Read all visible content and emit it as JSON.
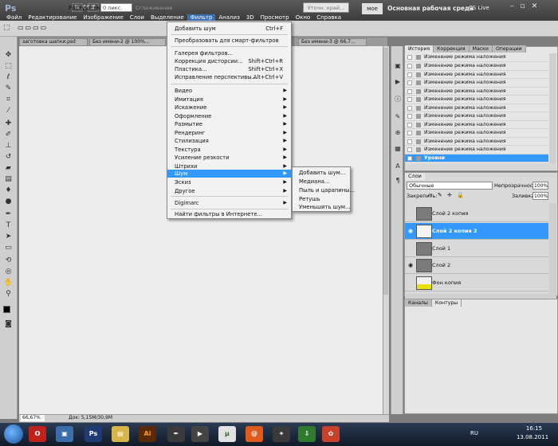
{
  "app": {
    "logo": "Ps",
    "zoom": "66,7",
    "workspace_chip": "мое",
    "workspace": "Основная рабочая среда",
    "cslive": "CS Live"
  },
  "menubar": [
    "Файл",
    "Редактирование",
    "Изображение",
    "Слои",
    "Выделение",
    "Фильтр",
    "Анализ",
    "3D",
    "Просмотр",
    "Окно",
    "Справка"
  ],
  "options": {
    "feather_label": "Растушевка:",
    "feather_value": "0 пикс.",
    "smooth": "Сглаживание",
    "refine": "Уточн. край..."
  },
  "doc_tabs": [
    "заготовка шапки.psd",
    "Без имени-2 @ 100%...",
    "Ф",
    "Без имени-3 @ 66,7..."
  ],
  "filter_menu": {
    "last_filter": "Добавить шум",
    "last_filter_shortcut": "Ctrl+F",
    "smart": "Преобразовать для смарт-фильтров",
    "gallery": "Галерея фильтров...",
    "lens": "Коррекция дисторсии...",
    "lens_shortcut": "Shift+Ctrl+R",
    "liquify": "Пластика...",
    "liquify_shortcut": "Shift+Ctrl+X",
    "vanish": "Исправление перспективы...",
    "vanish_shortcut": "Alt+Ctrl+V",
    "groups": [
      "Видео",
      "Имитация",
      "Искажение",
      "Оформление",
      "Размытие",
      "Рендеринг",
      "Стилизация",
      "Текстура",
      "Усиление резкости",
      "Штрихи",
      "Шум",
      "Эскиз",
      "Другое"
    ],
    "digimarc": "Digimarc",
    "online": "Найти фильтры в Интернете..."
  },
  "noise_submenu": [
    "Добавить шум...",
    "Медиана...",
    "Пыль и царапины...",
    "Ретушь",
    "Уменьшить шум..."
  ],
  "history": {
    "tabs": [
      "История",
      "Коррекция",
      "Маски",
      "Операции"
    ],
    "item": "Изменение режима наложения",
    "selected": "Уровни"
  },
  "layers": {
    "tab": "Слои",
    "blend_mode": "Обычные",
    "opacity_label": "Непрозрачность:",
    "opacity": "100%",
    "lock_label": "Закрепить:",
    "lock_icons": "▫ ✎ ✛ 🔒",
    "fill_label": "Заливка:",
    "fill": "100%",
    "rows": [
      "Слой 2 копия",
      "Слой 2 копия 2",
      "Слой 1",
      "Слой 2",
      "Фон копия"
    ]
  },
  "channels": {
    "tabs": [
      "Каналы",
      "Контуры"
    ]
  },
  "status": {
    "zoom": "66,67%",
    "doc": "Док: 5,15M/30,9M"
  },
  "taskbar": {
    "lang": "RU",
    "time": "16:15",
    "date": "13.08.2011"
  },
  "colors": {
    "accent": "#3399ff",
    "menu_active": "#3a6fb5"
  }
}
